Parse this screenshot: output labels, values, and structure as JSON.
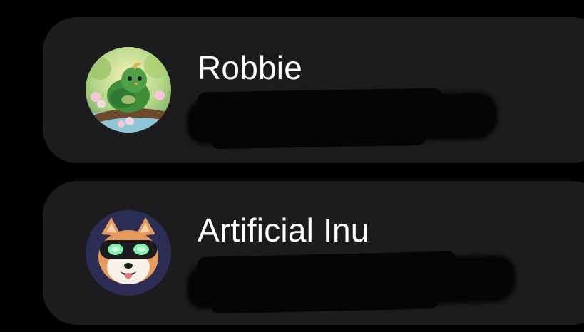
{
  "contacts": [
    {
      "name": "Robbie",
      "avatar_icon": "green-bird-avatar-icon",
      "redacted": true
    },
    {
      "name": "Artificial Inu",
      "avatar_icon": "shiba-dog-vr-goggles-avatar-icon",
      "redacted": true
    }
  ],
  "colors": {
    "background": "#000000",
    "card": "#1c1c1e",
    "name_text": "#ffffff",
    "redaction": "#050505",
    "dog_avatar_bg": "#2b2d55",
    "bird_green": "#3f8f3a"
  }
}
